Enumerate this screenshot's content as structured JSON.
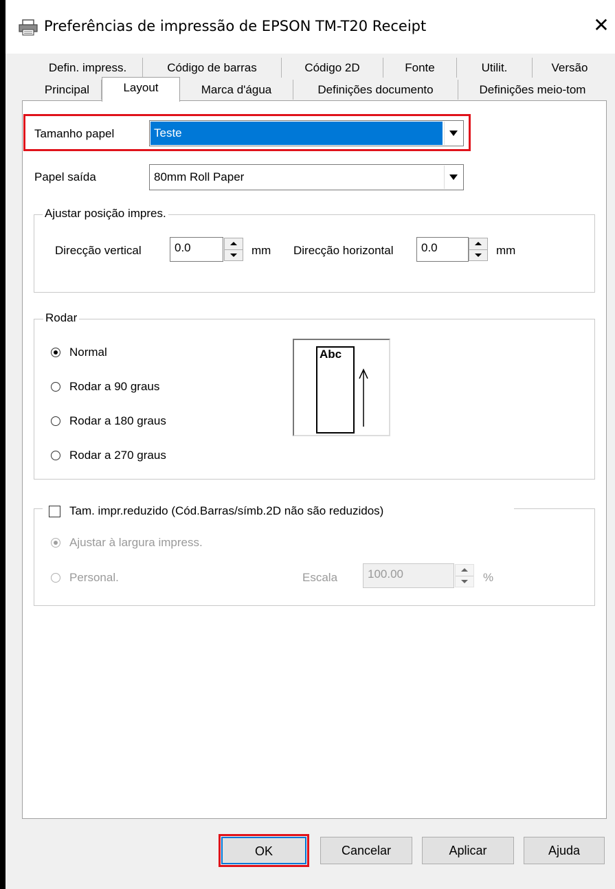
{
  "window": {
    "title": "Preferências de impressão de EPSON TM-T20 Receipt",
    "close_label": "✕"
  },
  "tabs_row1": [
    "Defin. impress.",
    "Código de barras",
    "Código 2D",
    "Fonte",
    "Utilit.",
    "Versão"
  ],
  "tabs_row2": [
    "Principal",
    "Layout",
    "Marca d'água",
    "Definições documento",
    "Definições meio-tom"
  ],
  "active_tab": "Layout",
  "paper_size": {
    "label": "Tamanho papel",
    "value": "Teste"
  },
  "paper_output": {
    "label": "Papel saída",
    "value": "80mm Roll Paper"
  },
  "adjust": {
    "legend": "Ajustar posição impres.",
    "vertical_label": "Direcção vertical",
    "vertical_value": "0.0",
    "vertical_unit": "mm",
    "horizontal_label": "Direcção horizontal",
    "horizontal_value": "0.0",
    "horizontal_unit": "mm"
  },
  "rotate": {
    "legend": "Rodar",
    "options": [
      "Normal",
      "Rodar a 90 graus",
      "Rodar a 180 graus",
      "Rodar a 270 graus"
    ],
    "selected": "Normal",
    "preview_text": "Abc"
  },
  "reduce": {
    "checkbox_label": "Tam. impr.reduzido (Cód.Barras/símb.2D não são reduzidos)",
    "checked": false,
    "option_fit": "Ajustar à largura impress.",
    "option_custom": "Personal.",
    "scale_label": "Escala",
    "scale_value": "100.00",
    "scale_unit": "%"
  },
  "buttons": {
    "ok": "OK",
    "cancel": "Cancelar",
    "apply": "Aplicar",
    "help": "Ajuda"
  },
  "colors": {
    "highlight": "#0078d7",
    "red_outline": "#e0131b"
  }
}
